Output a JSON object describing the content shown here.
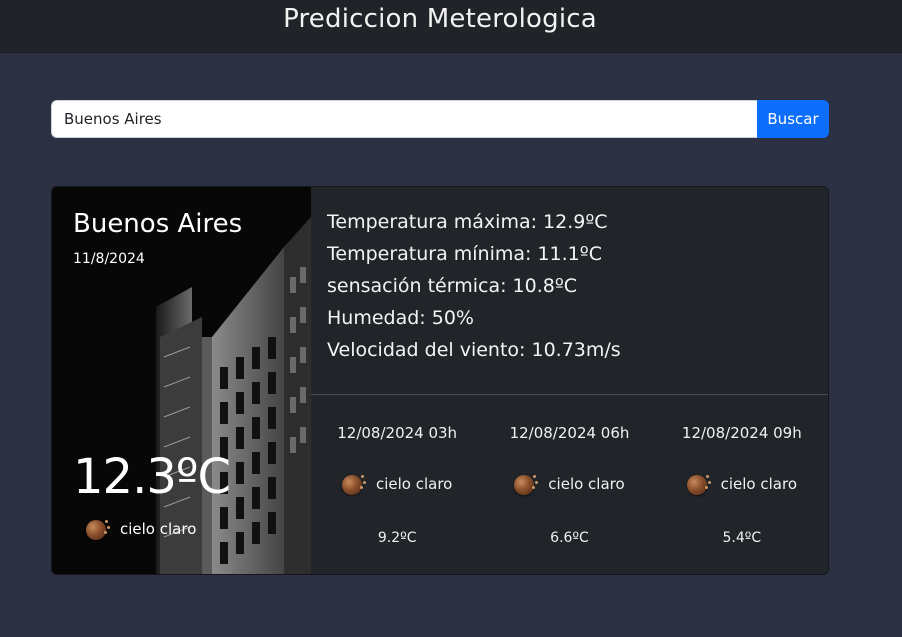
{
  "header": {
    "title": "Prediccion Meterologica"
  },
  "search": {
    "value": "Buenos Aires",
    "button_label": "Buscar"
  },
  "current": {
    "city": "Buenos Aires",
    "date": "11/8/2024",
    "temperature": "12.3ºC",
    "condition": "cielo claro",
    "condition_icon": "clear-sky-icon"
  },
  "details": {
    "max": "Temperatura máxima: 12.9ºC",
    "min": "Temperatura mínima: 11.1ºC",
    "feels": "sensación térmica: 10.8ºC",
    "humidity": "Humedad: 50%",
    "wind": "Velocidad del viento: 10.73m/s"
  },
  "forecast": [
    {
      "datetime": "12/08/2024 03h",
      "condition": "cielo claro",
      "temp": "9.2ºC"
    },
    {
      "datetime": "12/08/2024 06h",
      "condition": "cielo claro",
      "temp": "6.6ºC"
    },
    {
      "datetime": "12/08/2024 09h",
      "condition": "cielo claro",
      "temp": "5.4ºC"
    }
  ],
  "colors": {
    "accent": "#0d6efd",
    "background": "#2b3142",
    "card": "#212529",
    "topbar": "#202328"
  }
}
